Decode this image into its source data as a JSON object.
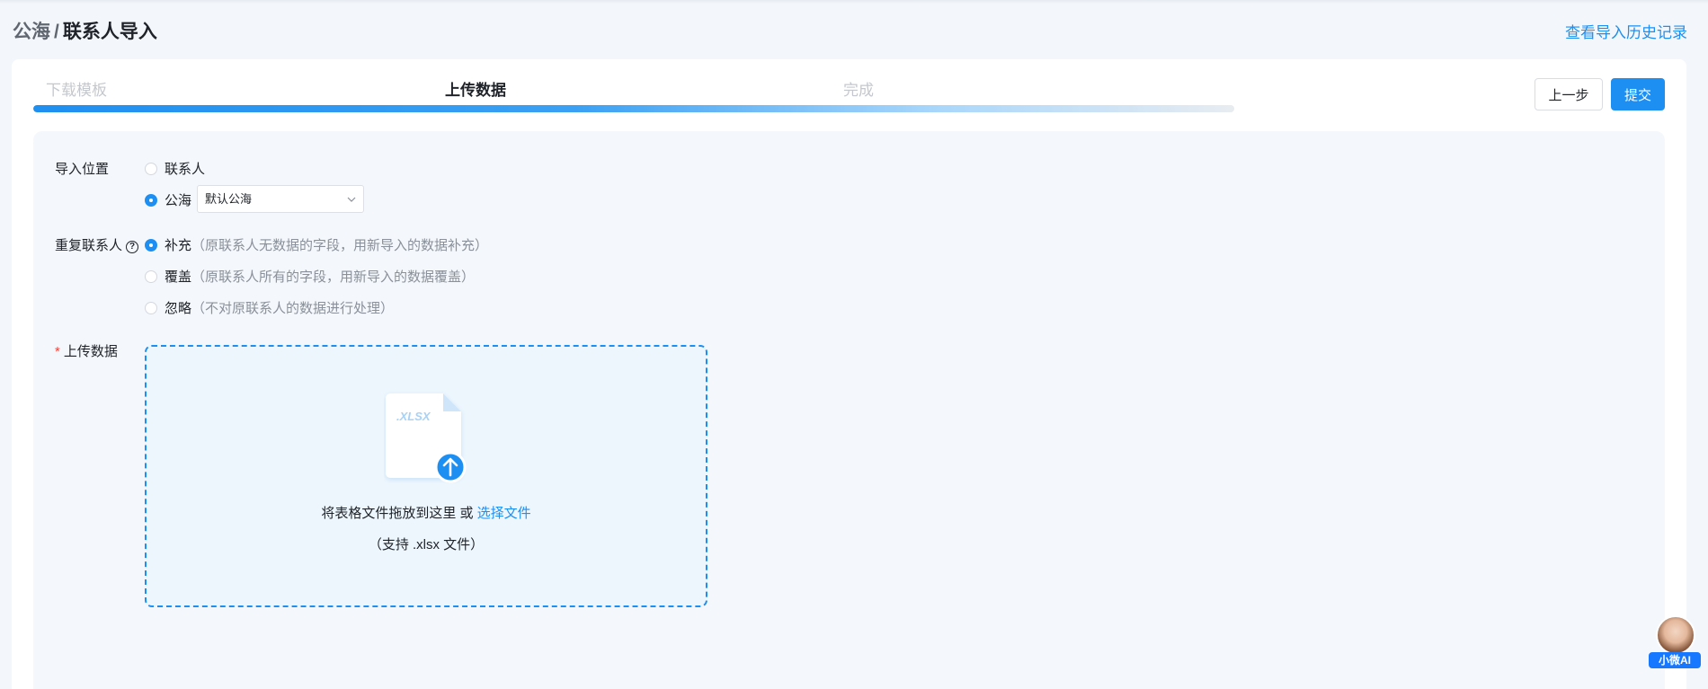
{
  "header": {
    "breadcrumb_parent": "公海",
    "breadcrumb_separator": "/",
    "breadcrumb_current": "联系人导入",
    "history_link": "查看导入历史记录"
  },
  "steps": {
    "items": [
      {
        "label": "下载模板",
        "state": "done"
      },
      {
        "label": "上传数据",
        "state": "active"
      },
      {
        "label": "完成",
        "state": "todo"
      }
    ],
    "progress_percent": 100
  },
  "actions": {
    "prev_label": "上一步",
    "submit_label": "提交"
  },
  "form": {
    "import_location": {
      "label": "导入位置",
      "options": [
        {
          "label": "联系人",
          "checked": false
        },
        {
          "label": "公海",
          "checked": true
        }
      ],
      "pool_select_value": "默认公海"
    },
    "duplicate": {
      "label": "重复联系人",
      "help_icon": "question-circle-icon",
      "options": [
        {
          "label": "补充",
          "desc": "（原联系人无数据的字段，用新导入的数据补充）",
          "checked": true
        },
        {
          "label": "覆盖",
          "desc": "（原联系人所有的字段，用新导入的数据覆盖）",
          "checked": false
        },
        {
          "label": "忽略",
          "desc": "（不对原联系人的数据进行处理）",
          "checked": false
        }
      ]
    },
    "upload": {
      "label": "上传数据",
      "required_mark": "*",
      "file_icon_text": ".XLSX",
      "drop_text": "将表格文件拖放到这里 或 ",
      "select_link": "选择文件",
      "hint": "（支持 .xlsx 文件）"
    }
  },
  "assistant": {
    "badge": "小微AI"
  },
  "colors": {
    "accent": "#1e8ff2",
    "background": "#f3f7fb",
    "required": "#f0463c"
  }
}
